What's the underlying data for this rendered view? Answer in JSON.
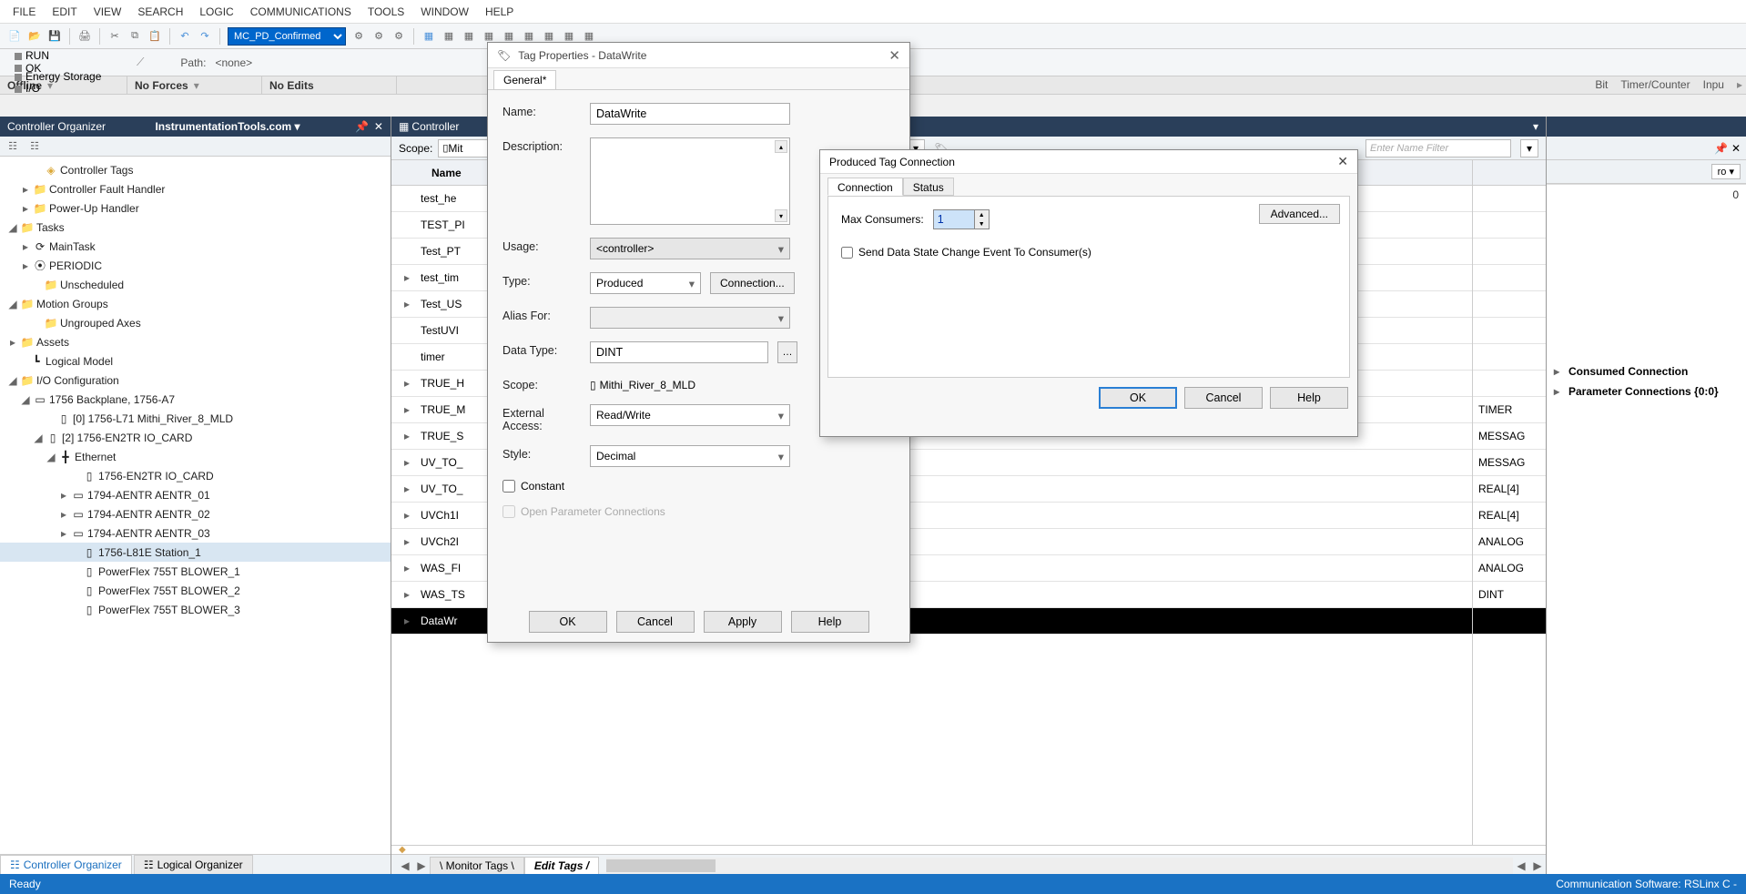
{
  "menu": [
    "FILE",
    "EDIT",
    "VIEW",
    "SEARCH",
    "LOGIC",
    "COMMUNICATIONS",
    "TOOLS",
    "WINDOW",
    "HELP"
  ],
  "toolbar_combo": "MC_PD_Confirmed",
  "status_lights": {
    "run": "RUN",
    "ok": "OK",
    "es": "Energy Storage",
    "io": "I/O"
  },
  "path_label": "Path:",
  "path_value": "<none>",
  "state": {
    "offline": "Offline",
    "forces": "No Forces",
    "edits": "No Edits"
  },
  "ribbon": {
    "bit": "Bit",
    "tc": "Timer/Counter",
    "inp": "Inpu"
  },
  "left": {
    "panel_title": "Controller Organizer",
    "brand": "InstrumentationTools.com ▾",
    "nodes": [
      {
        "pad": 34,
        "tw": "",
        "ic": "◈",
        "label": "Controller Tags",
        "cls": "",
        "icolor": "#dca93a"
      },
      {
        "pad": 22,
        "tw": "▸",
        "ic": "📁",
        "label": "Controller Fault Handler",
        "cls": "folder"
      },
      {
        "pad": 22,
        "tw": "▸",
        "ic": "📁",
        "label": "Power-Up Handler",
        "cls": "folder"
      },
      {
        "pad": 8,
        "tw": "◢",
        "ic": "📁",
        "label": "Tasks",
        "cls": "folder"
      },
      {
        "pad": 22,
        "tw": "▸",
        "ic": "⟳",
        "label": "MainTask"
      },
      {
        "pad": 22,
        "tw": "▸",
        "ic": "⦿",
        "label": "PERIODIC"
      },
      {
        "pad": 34,
        "tw": "",
        "ic": "📁",
        "label": "Unscheduled",
        "cls": "folder"
      },
      {
        "pad": 8,
        "tw": "◢",
        "ic": "📁",
        "label": "Motion Groups",
        "cls": "folder"
      },
      {
        "pad": 34,
        "tw": "",
        "ic": "📁",
        "label": "Ungrouped Axes",
        "cls": "folder"
      },
      {
        "pad": 8,
        "tw": "▸",
        "ic": "📁",
        "label": "Assets",
        "cls": "folder"
      },
      {
        "pad": 18,
        "tw": "",
        "ic": "┗",
        "label": "Logical Model"
      },
      {
        "pad": 8,
        "tw": "◢",
        "ic": "📁",
        "label": "I/O Configuration",
        "cls": "folder"
      },
      {
        "pad": 22,
        "tw": "◢",
        "ic": "▭",
        "label": "1756 Backplane, 1756-A7"
      },
      {
        "pad": 48,
        "tw": "",
        "ic": "▯",
        "label": "[0] 1756-L71 Mithi_River_8_MLD"
      },
      {
        "pad": 36,
        "tw": "◢",
        "ic": "▯",
        "label": "[2] 1756-EN2TR IO_CARD"
      },
      {
        "pad": 50,
        "tw": "◢",
        "ic": "╋",
        "label": "Ethernet"
      },
      {
        "pad": 76,
        "tw": "",
        "ic": "▯",
        "label": "1756-EN2TR IO_CARD"
      },
      {
        "pad": 64,
        "tw": "▸",
        "ic": "▭",
        "label": "1794-AENTR AENTR_01"
      },
      {
        "pad": 64,
        "tw": "▸",
        "ic": "▭",
        "label": "1794-AENTR AENTR_02"
      },
      {
        "pad": 64,
        "tw": "▸",
        "ic": "▭",
        "label": "1794-AENTR AENTR_03"
      },
      {
        "pad": 76,
        "tw": "",
        "ic": "▯",
        "label": "1756-L81E Station_1",
        "sel": true
      },
      {
        "pad": 76,
        "tw": "",
        "ic": "▯",
        "label": "PowerFlex 755T BLOWER_1"
      },
      {
        "pad": 76,
        "tw": "",
        "ic": "▯",
        "label": "PowerFlex 755T BLOWER_2"
      },
      {
        "pad": 76,
        "tw": "",
        "ic": "▯",
        "label": "PowerFlex 755T BLOWER_3"
      }
    ],
    "tab_active": "Controller Organizer",
    "tab_other": "Logical Organizer"
  },
  "center": {
    "title": "Controller",
    "scope_label": "Scope:",
    "scope_value": "Mit",
    "filter_placeholder": "Enter Name Filter",
    "col_name": "Name",
    "rows": [
      {
        "exp": "",
        "name": "test_he",
        "type": ""
      },
      {
        "exp": "",
        "name": "TEST_PI",
        "type": ""
      },
      {
        "exp": "",
        "name": "Test_PT",
        "type": ""
      },
      {
        "exp": "▸",
        "name": "test_tim",
        "type": ""
      },
      {
        "exp": "▸",
        "name": "Test_US",
        "type": ""
      },
      {
        "exp": "",
        "name": "TestUVI",
        "type": ""
      },
      {
        "exp": "",
        "name": "timer",
        "type": ""
      },
      {
        "exp": "▸",
        "name": "TRUE_H",
        "type": ""
      },
      {
        "exp": "▸",
        "name": "TRUE_M",
        "type": "TIMER"
      },
      {
        "exp": "▸",
        "name": "TRUE_S",
        "type": "MESSAG"
      },
      {
        "exp": "▸",
        "name": "UV_TO_",
        "type": "MESSAG"
      },
      {
        "exp": "▸",
        "name": "UV_TO_",
        "type": "REAL[4]"
      },
      {
        "exp": "▸",
        "name": "UVCh1I",
        "type": "REAL[4]"
      },
      {
        "exp": "▸",
        "name": "UVCh2I",
        "type": "ANALOG"
      },
      {
        "exp": "▸",
        "name": "WAS_FI",
        "type": "ANALOG"
      },
      {
        "exp": "▸",
        "name": "WAS_TS",
        "type": "DINT",
        "hl": true
      },
      {
        "exp": "▸",
        "name": "DataWr",
        "type": "",
        "hl": true
      }
    ],
    "tab_monitor": "Monitor Tags",
    "tab_edit": "Edit Tags"
  },
  "right": {
    "dd": "ro ▾",
    "zero": "0",
    "p1": "Consumed Connection",
    "p2": "Parameter Connections {0:0}"
  },
  "dlg1": {
    "title": "Tag Properties - DataWrite",
    "tab": "General*",
    "name_l": "Name:",
    "name_v": "DataWrite",
    "desc_l": "Description:",
    "usage_l": "Usage:",
    "usage_v": "<controller>",
    "type_l": "Type:",
    "type_v": "Produced",
    "conn_btn": "Connection...",
    "alias_l": "Alias For:",
    "dtype_l": "Data Type:",
    "dtype_v": "DINT",
    "scope_l": "Scope:",
    "scope_v": "Mithi_River_8_MLD",
    "ext_l": "External Access:",
    "ext_v": "Read/Write",
    "style_l": "Style:",
    "style_v": "Decimal",
    "constant": "Constant",
    "openparam": "Open Parameter Connections",
    "ok": "OK",
    "cancel": "Cancel",
    "apply": "Apply",
    "help": "Help"
  },
  "dlg2": {
    "title": "Produced Tag Connection",
    "tab_conn": "Connection",
    "tab_stat": "Status",
    "max_l": "Max Consumers:",
    "max_v": "1",
    "adv": "Advanced...",
    "chk": "Send Data State Change Event To Consumer(s)",
    "ok": "OK",
    "cancel": "Cancel",
    "help": "Help"
  },
  "statusbar": {
    "ready": "Ready",
    "comm": "Communication Software: RSLinx C -"
  }
}
